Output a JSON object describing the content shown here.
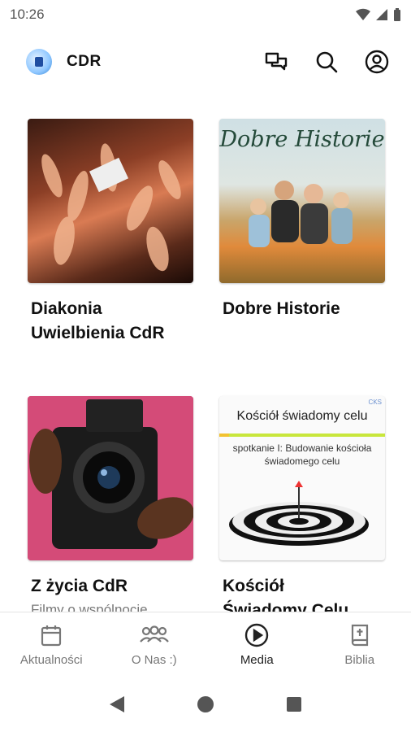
{
  "status": {
    "time": "10:26"
  },
  "app": {
    "name": "CDR"
  },
  "cards": [
    {
      "title_line1": "Diakonia",
      "title_line2": "Uwielbienia CdR"
    },
    {
      "title_line1": "Dobre Historie",
      "thumb_text": "Dobre Historie"
    },
    {
      "title_line1": "Z życia CdR",
      "subtitle": "Filmy o wspólnocie"
    },
    {
      "title_line1": "Kościół",
      "title_line2": "Świadomy Celu",
      "thumb_heading": "Kościół świadomy celu",
      "thumb_sub": "spotkanie I: Budowanie kościoła świadomego celu",
      "thumb_tag": "CKS"
    }
  ],
  "nav": [
    {
      "label": "Aktualności",
      "icon": "calendar-icon"
    },
    {
      "label": "O Nas :)",
      "icon": "group-icon"
    },
    {
      "label": "Media",
      "icon": "play-circle-icon"
    },
    {
      "label": "Biblia",
      "icon": "bible-icon"
    }
  ],
  "colors": {
    "accent_green": "#c8e63c",
    "text": "#111111",
    "muted": "#777777"
  }
}
